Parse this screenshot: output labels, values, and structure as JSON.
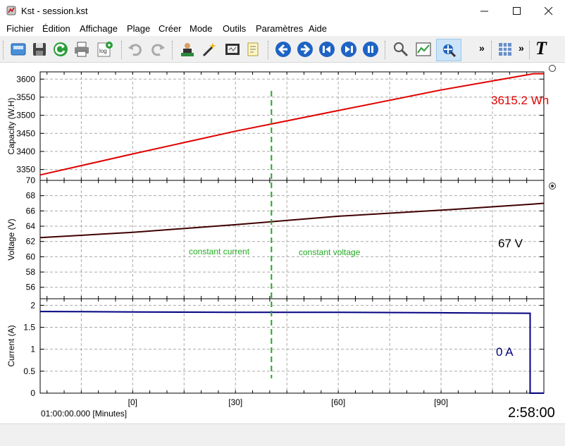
{
  "window": {
    "title": "Kst - session.kst"
  },
  "menu": [
    "Fichier",
    "Édition",
    "Affichage",
    "Plage",
    "Créer",
    "Mode",
    "Outils",
    "Paramètres",
    "Aide"
  ],
  "toolbar": {
    "icons": [
      "new-icon",
      "save-icon",
      "reload-icon",
      "print-icon",
      "log-icon",
      "undo-icon",
      "redo-icon",
      "data-manager-icon",
      "wand-icon",
      "video-icon",
      "notes-icon",
      "back-icon",
      "forward-icon",
      "first-icon",
      "last-icon",
      "pause-icon",
      "zoom-tool-icon",
      "plot-layout-icon",
      "pan-icon",
      "grid-icon",
      "text-icon"
    ],
    "overflow": "»",
    "text_tool": "T"
  },
  "plots": {
    "capacity": {
      "ylabel": "Capacity (W.H)",
      "value_label": "3615.2 Wh",
      "color": "#e00000"
    },
    "voltage": {
      "ylabel": "Voltage (V)",
      "value_label": "67 V",
      "color": "#000000",
      "annotations": [
        "constant current",
        "constant voltage"
      ]
    },
    "current": {
      "ylabel": "Current (A)",
      "value_label": "0 A",
      "color": "#000080"
    }
  },
  "xaxis": {
    "ticks": [
      "[0]",
      "[30]",
      "[60]",
      "[90]"
    ],
    "label": "01:00:00.000 [Minutes]"
  },
  "clock": "2:58:00",
  "chart_data": [
    {
      "type": "line",
      "ylabel": "Capacity (W.H)",
      "x": [
        -27,
        0,
        30,
        60,
        90,
        117,
        120
      ],
      "series": [
        {
          "values": [
            3335,
            3393,
            3456,
            3513,
            3570,
            3615,
            3615
          ]
        }
      ],
      "ylim": [
        3320,
        3620
      ],
      "yticks": [
        3350,
        3400,
        3450,
        3500,
        3550,
        3600
      ],
      "grid": true
    },
    {
      "type": "line",
      "ylabel": "Voltage (V)",
      "x": [
        -27,
        0,
        30,
        60,
        90,
        117,
        120
      ],
      "series": [
        {
          "values": [
            62.5,
            63.2,
            64.2,
            65.3,
            66.1,
            66.9,
            67.0
          ]
        }
      ],
      "ylim": [
        54.5,
        70
      ],
      "yticks": [
        56,
        58,
        60,
        62,
        64,
        66,
        68,
        70
      ],
      "grid": true
    },
    {
      "type": "line",
      "ylabel": "Current (A)",
      "x": [
        -27,
        0,
        30,
        60,
        90,
        116,
        116,
        120
      ],
      "series": [
        {
          "values": [
            1.86,
            1.85,
            1.84,
            1.84,
            1.83,
            1.82,
            0,
            0
          ]
        }
      ],
      "ylim": [
        0,
        2.15
      ],
      "yticks": [
        0,
        0.5,
        1,
        1.5,
        2
      ],
      "grid": true
    }
  ],
  "transition_marker": {
    "x": 40.5,
    "color": "#22aa22"
  }
}
